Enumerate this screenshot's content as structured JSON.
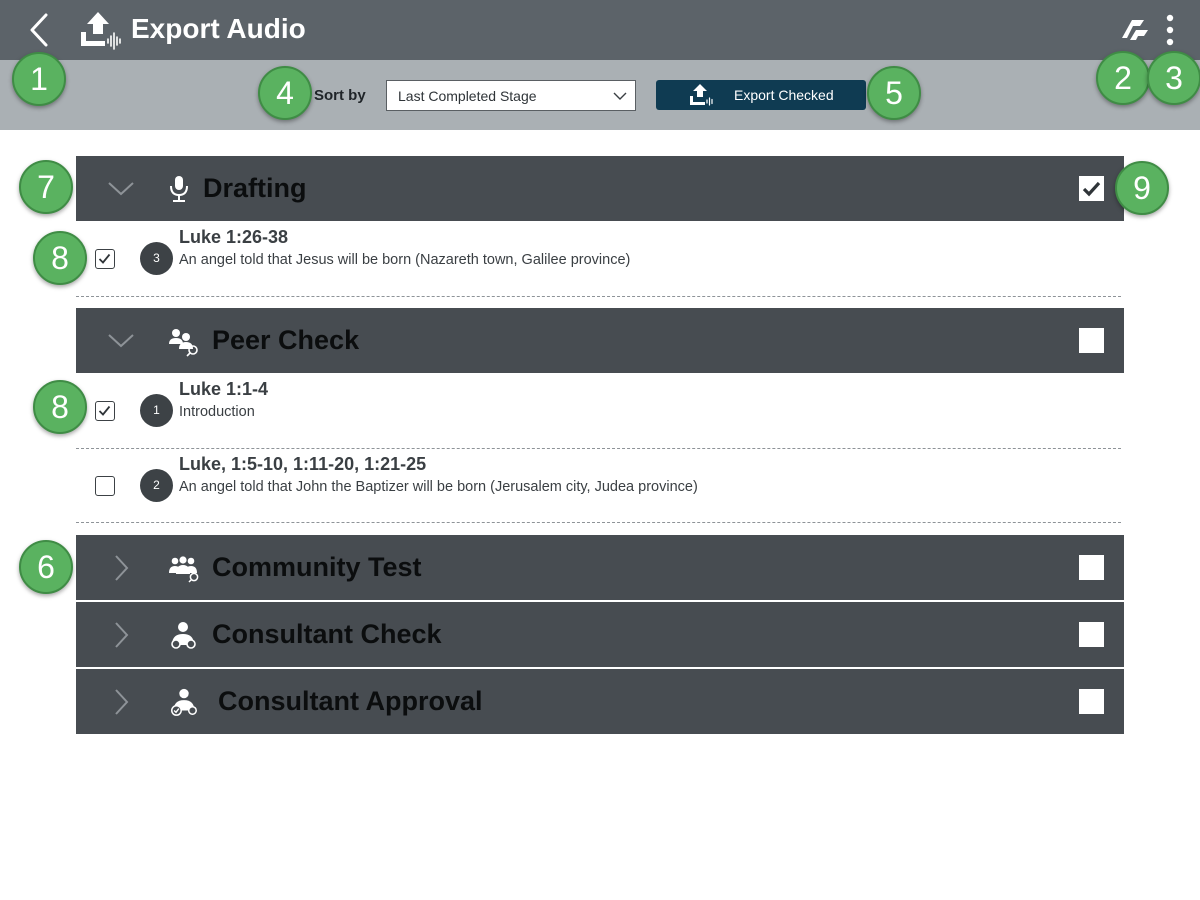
{
  "header": {
    "title": "Export Audio",
    "back_icon": "chevron-left-icon",
    "title_icon": "upload-audio-icon",
    "sync_icon": "sync-icon",
    "more_icon": "more-vertical-icon"
  },
  "toolbar": {
    "sort_label": "Sort by",
    "sort_value": "Last Completed Stage",
    "export_label": "Export Checked"
  },
  "stages": [
    {
      "title": "Drafting",
      "icon": "microphone-icon",
      "expanded": true,
      "checked": true
    },
    {
      "title": "Peer Check",
      "icon": "peer-check-icon",
      "expanded": true,
      "checked": false
    },
    {
      "title": "Community Test",
      "icon": "community-icon",
      "expanded": false,
      "checked": false
    },
    {
      "title": "Consultant Check",
      "icon": "consultant-icon",
      "expanded": false,
      "checked": false
    },
    {
      "title": "Consultant Approval",
      "icon": "consultant-approval-icon",
      "expanded": false,
      "checked": false
    }
  ],
  "passages": [
    {
      "stage": "Drafting",
      "number": "3",
      "reference": "Luke 1:26-38",
      "description": "An angel told that Jesus will be born (Nazareth town, Galilee province)",
      "checked": true
    },
    {
      "stage": "Peer Check",
      "number": "1",
      "reference": "Luke 1:1-4",
      "description": "Introduction",
      "checked": true
    },
    {
      "stage": "Peer Check",
      "number": "2",
      "reference": "Luke, 1:5-10, 1:11-20, 1:21-25",
      "description": "An angel told that John the Baptizer will be born (Jerusalem city, Judea province)",
      "checked": false
    }
  ],
  "callouts": [
    "1",
    "2",
    "3",
    "4",
    "5",
    "6",
    "7",
    "8",
    "8",
    "9"
  ],
  "colors": {
    "header_bg": "#5c6369",
    "toolbar_bg": "#aab0b4",
    "stage_bg": "#474c51",
    "export_button_bg": "#0f3b52",
    "callout_bg": "#5ab260"
  }
}
